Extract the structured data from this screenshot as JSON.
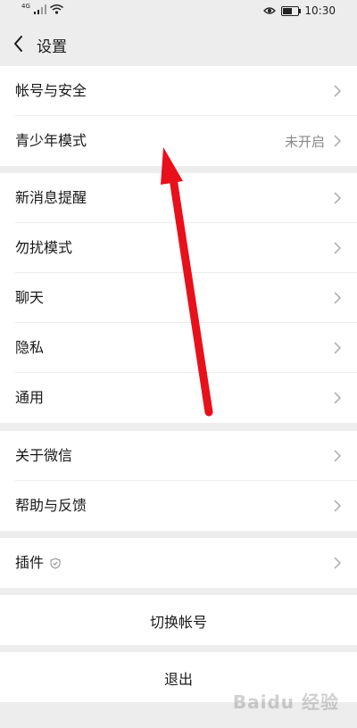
{
  "status_bar": {
    "network_tag": "4G",
    "time": "10:30",
    "battery_level_percent": 60
  },
  "header": {
    "title": "设置"
  },
  "groups": [
    {
      "items": [
        {
          "label": "帐号与安全",
          "value": ""
        },
        {
          "label": "青少年模式",
          "value": "未开启"
        }
      ]
    },
    {
      "items": [
        {
          "label": "新消息提醒",
          "value": ""
        },
        {
          "label": "勿扰模式",
          "value": ""
        },
        {
          "label": "聊天",
          "value": ""
        },
        {
          "label": "隐私",
          "value": ""
        },
        {
          "label": "通用",
          "value": ""
        }
      ]
    },
    {
      "items": [
        {
          "label": "关于微信",
          "value": ""
        },
        {
          "label": "帮助与反馈",
          "value": ""
        }
      ]
    },
    {
      "items": [
        {
          "label": "插件",
          "value": ""
        }
      ]
    }
  ],
  "actions": {
    "switch_account": "切换帐号",
    "logout": "退出"
  },
  "annotation": {
    "arrow_color": "#e8101a"
  },
  "watermark": {
    "text": "Baidu 经验"
  },
  "icons": [
    "back-chevron-icon",
    "chevron-right-icon",
    "shield-icon",
    "signal-icon",
    "wifi-icon",
    "eye-icon",
    "battery-icon"
  ]
}
